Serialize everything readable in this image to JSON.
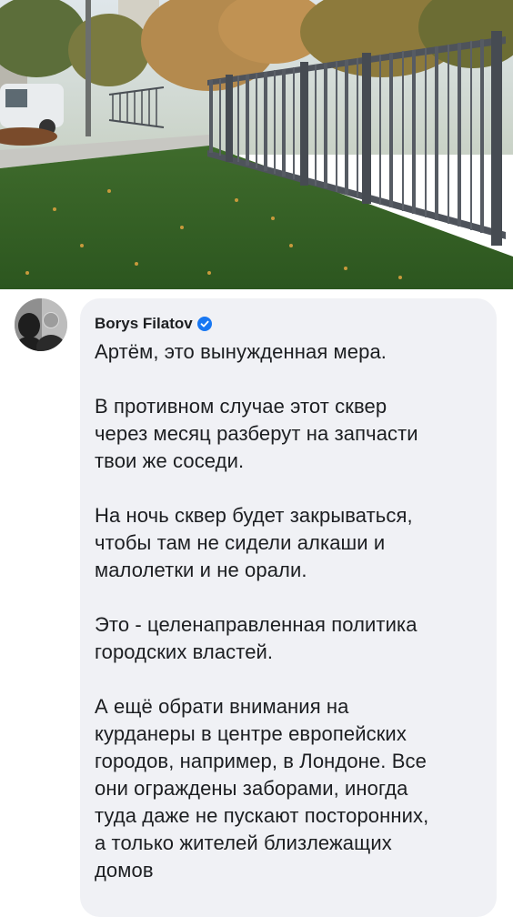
{
  "comment": {
    "author": "Borys Filatov",
    "text": "Артём, это вынужденная мера.\n\nВ противном случае этот сквер\nчерез месяц разберут на запчасти\nтвои же соседи.\n\nНа ночь сквер будет закрываться,\nчтобы там не сидели алкаши и\nмалолетки и не орали.\n\nЭто - целенаправленная политика\nгородских властей.\n\nА ещё обрати внимания на\nкурданеры в центре европейских\nгородов, например, в Лондоне. Все\nони ограждены заборами, иногда\nтуда даже не пускают посторонних,\nа только жителей близлежащих\nдомов"
  },
  "icons": {
    "verified": "verified-badge-icon",
    "avatar": "avatar"
  },
  "colors": {
    "bubble": "#f0f1f5",
    "text": "#1c1e21",
    "verified": "#1877f2"
  }
}
